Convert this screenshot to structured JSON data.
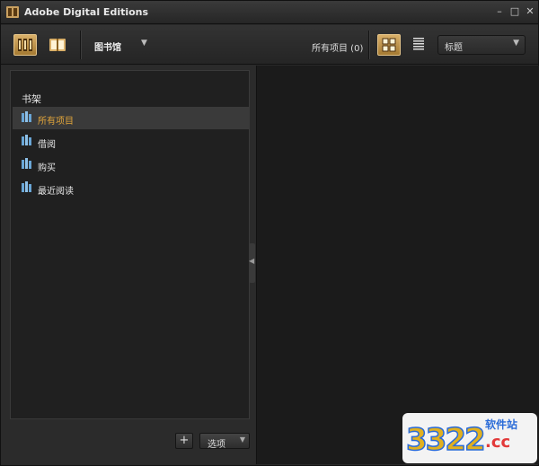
{
  "window": {
    "title": "Adobe Digital Editions",
    "controls": [
      "minimize",
      "maximize",
      "close"
    ]
  },
  "toolbar": {
    "library_label": "图书馆",
    "items_count_label": "所有项目 (0)",
    "sort_select": {
      "value": "标题"
    }
  },
  "shelf": {
    "title": "书架",
    "items": [
      {
        "label": "所有项目",
        "selected": true
      },
      {
        "label": "借阅",
        "selected": false
      },
      {
        "label": "购买",
        "selected": false
      },
      {
        "label": "最近阅读",
        "selected": false
      }
    ]
  },
  "footer": {
    "add_label": "+",
    "options_label": "选项"
  },
  "watermark": {
    "number": "3322",
    "site": "软件站",
    "suffix": ".cc"
  },
  "colors": {
    "accent": "#d9b06a",
    "selected_text": "#e0a43a",
    "background": "#2a2a2a",
    "icon_blue": "#6aa6d6"
  }
}
